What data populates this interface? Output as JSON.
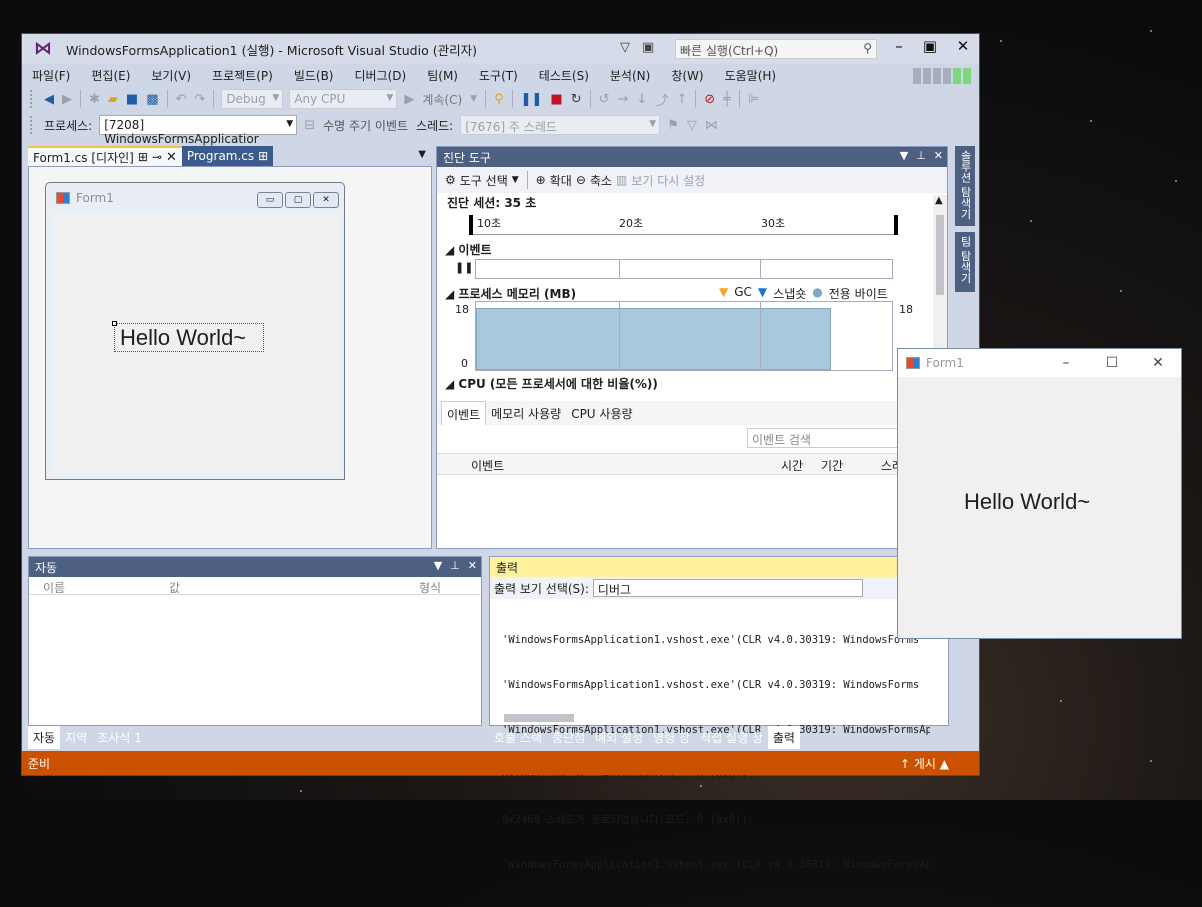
{
  "window": {
    "title": "WindowsFormsApplication1 (실행) - Microsoft Visual Studio (관리자)",
    "quick_launch_placeholder": "빠른 실행(Ctrl+Q)"
  },
  "menu": [
    "파일(F)",
    "편집(E)",
    "보기(V)",
    "프로젝트(P)",
    "빌드(B)",
    "디버그(D)",
    "팀(M)",
    "도구(T)",
    "테스트(S)",
    "분석(N)",
    "창(W)",
    "도움말(H)"
  ],
  "toolbar": {
    "config": "Debug",
    "platform": "Any CPU",
    "continue": "계속(C)",
    "process_label": "프로세스:",
    "process": "[7208] WindowsFormsApplicatior",
    "lifecycle": "수명 주기 이벤트",
    "thread_label": "스레드:",
    "thread": "[7676] 주 스레드"
  },
  "doc_tabs": [
    {
      "label": "Form1.cs [디자인]"
    },
    {
      "label": "Program.cs"
    }
  ],
  "designer": {
    "form_title": "Form1",
    "label_text": "Hello World~"
  },
  "diag": {
    "title": "진단 도구",
    "tools": {
      "select": "도구 선택",
      "zoom_in": "확대",
      "zoom_out": "축소",
      "reset": "보기 다시 설정"
    },
    "session": "진단 세션: 35 초",
    "ruler": [
      "10초",
      "20초",
      "30초"
    ],
    "events_header": "이벤트",
    "memory_header": "프로세스 메모리 (MB)",
    "legend": {
      "gc": "GC",
      "snapshot": "스냅숏",
      "private": "전용 바이트"
    },
    "mem_max": "18",
    "mem_min": "0",
    "cpu_header": "CPU (모든 프로세서에 대한 비율(%))",
    "tabs": [
      "이벤트",
      "메모리 사용량",
      "CPU 사용량"
    ],
    "search_placeholder": "이벤트 검색",
    "cols": {
      "event": "이벤트",
      "time": "시간",
      "duration": "기간",
      "thread": "스레"
    }
  },
  "side_tabs": [
    "솔루션 탐색기",
    "팀 탐색기"
  ],
  "auto": {
    "title": "자동",
    "cols": {
      "name": "이름",
      "value": "값",
      "type": "형식"
    },
    "tabs": [
      "자동",
      "지역",
      "조사식 1"
    ]
  },
  "output": {
    "title": "출력",
    "select_label": "출력 보기 선택(S):",
    "select_value": "디버그",
    "lines": [
      "'WindowsFormsApplication1.vshost.exe'(CLR v4.0.30319: WindowsForms",
      "'WindowsFormsApplication1.vshost.exe'(CLR v4.0.30319: WindowsForms",
      "'WindowsFormsApplication1.vshost.exe'(CLR v4.0.30319: WindowsFormsAppli",
      "0x2a88 스레드가 종료되었습니다(코드: 0 (0x0)).",
      "0x2468 스레드가 종료되었습니다(코드: 0 (0x0)).",
      "'WindowsFormsApplication1.vshost.exe'(CLR v4.0.30319: WindowsFormsApplic"
    ],
    "tabs": [
      "호출 스택",
      "중단점",
      "예외 설정",
      "명령 창",
      "직접 실행 창",
      "출력"
    ]
  },
  "status": {
    "text": "준비",
    "publish": "게시"
  },
  "run_form": {
    "title": "Form1",
    "label_text": "Hello World~"
  },
  "colors": {
    "status": "#ca5100",
    "panel_header": "#4d6082",
    "output_header": "#fff29d"
  }
}
